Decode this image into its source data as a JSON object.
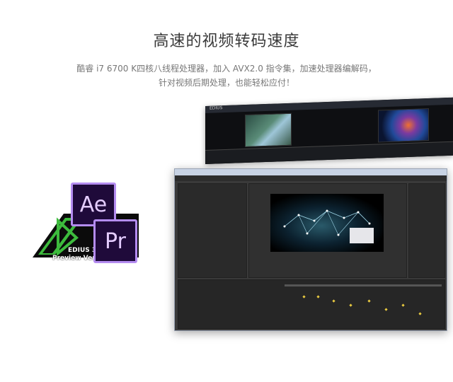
{
  "headline": "高速的视频转码速度",
  "description": {
    "line1": "酷睿 i7 6700 K四核八线程处理器，加入 AVX2.0 指令集，加速处理器编解码，",
    "line2": "针对视频后期处理，也能轻松应付！"
  },
  "logos": {
    "ae": "Ae",
    "pr": "Pr",
    "edius_line1": "EDIUS 3D",
    "edius_line2": "Preview Version"
  },
  "edius_window": {
    "title": "EDIUS"
  },
  "colors": {
    "ae_pr_border": "#b48cf0",
    "ae_pr_fill": "#1f0a3a",
    "edius_green": "#3dbb3d",
    "keyframe": "#e8c940"
  }
}
